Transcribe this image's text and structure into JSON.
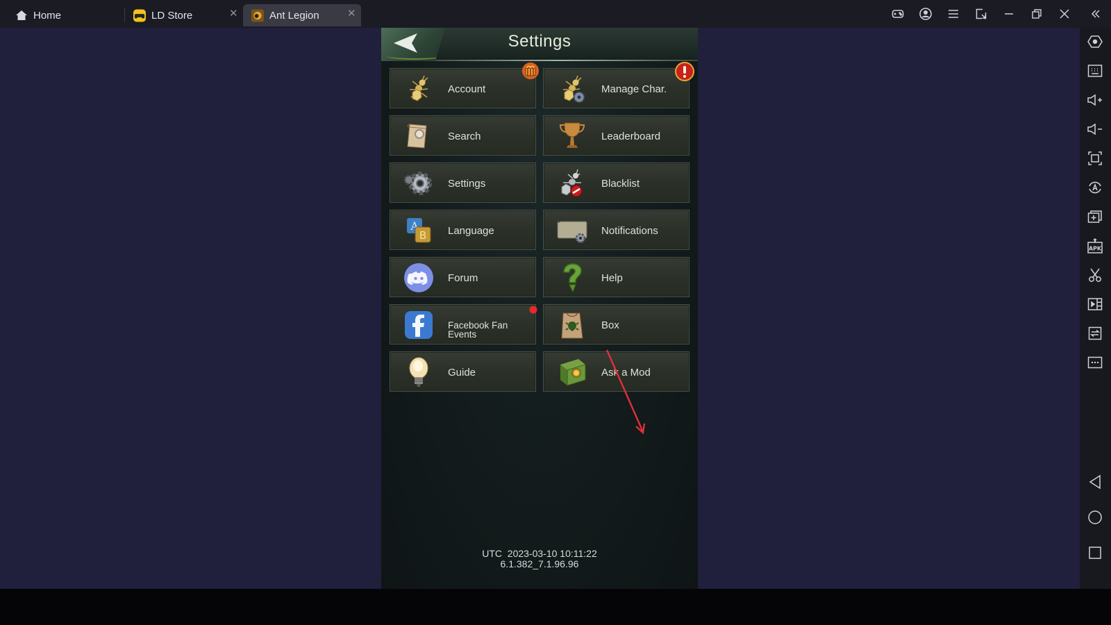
{
  "tabs": [
    {
      "label": "Home",
      "icon": "home-icon",
      "closable": false
    },
    {
      "label": "LD Store",
      "icon": "ld-store-icon",
      "closable": true
    },
    {
      "label": "Ant Legion",
      "icon": "ant-legion-icon",
      "closable": true,
      "active": true
    }
  ],
  "window_controls": [
    "gamepad-icon",
    "account-icon",
    "menu-icon",
    "screen-resize-icon",
    "minimize-icon",
    "restore-icon",
    "close-icon",
    "collapse-sidebar-icon"
  ],
  "sidebar": {
    "items": [
      {
        "name": "settings-hex-icon",
        "title": "Settings"
      },
      {
        "name": "keyboard-icon",
        "title": "Keyboard mapping"
      },
      {
        "name": "volume-up-icon",
        "title": "Volume up"
      },
      {
        "name": "volume-down-icon",
        "title": "Volume down"
      },
      {
        "name": "fullscreen-icon",
        "title": "Full screen"
      },
      {
        "name": "auto-rotate-icon",
        "title": "Auto rotate"
      },
      {
        "name": "multi-instance-icon",
        "title": "Multi-instance"
      },
      {
        "name": "install-apk-icon",
        "title": "Install APK",
        "text": "APK"
      },
      {
        "name": "screenshot-icon",
        "title": "Screenshot"
      },
      {
        "name": "record-icon",
        "title": "Record"
      },
      {
        "name": "sync-icon",
        "title": "Synchronizer"
      },
      {
        "name": "more-icon",
        "title": "More"
      }
    ],
    "nav": [
      {
        "name": "android-back-icon",
        "title": "Back"
      },
      {
        "name": "android-home-icon",
        "title": "Home"
      },
      {
        "name": "android-recents-icon",
        "title": "Recents"
      }
    ]
  },
  "game": {
    "title": "Settings",
    "buttons": [
      {
        "label": "Account",
        "icon": "ant-icon",
        "badge": "gift"
      },
      {
        "label": "Manage Char.",
        "icon": "ant-gear-icon",
        "badge": "alert"
      },
      {
        "label": "Search",
        "icon": "scroll-search-icon"
      },
      {
        "label": "Leaderboard",
        "icon": "trophy-icon"
      },
      {
        "label": "Settings",
        "icon": "gear-icon"
      },
      {
        "label": "Blacklist",
        "icon": "ant-block-icon"
      },
      {
        "label": "Language",
        "icon": "language-ab-icon"
      },
      {
        "label": "Notifications",
        "icon": "notification-gear-icon"
      },
      {
        "label": "Forum",
        "icon": "discord-icon"
      },
      {
        "label": "Help",
        "icon": "question-icon"
      },
      {
        "label": "Facebook Fan Events",
        "label_line1": "Facebook Fan",
        "label_line2": "Events",
        "icon": "facebook-icon",
        "badge": "dot"
      },
      {
        "label": "Box",
        "icon": "bag-icon"
      },
      {
        "label": "Guide",
        "icon": "lightbulb-icon"
      },
      {
        "label": "Ask a Mod",
        "icon": "book-icon"
      }
    ],
    "footer": {
      "utc_line": "UTC  2023-03-10 10:11:22",
      "version": "6.1.382_7.1.96.96"
    }
  },
  "colors": {
    "desktop_bg": "#201f3c",
    "topbar_bg": "#1b1b24",
    "active_tab": "#3a3a44",
    "annotation_arrow": "#e0303a",
    "alert_red": "#c8221a",
    "gift_orange": "#d9621e"
  }
}
